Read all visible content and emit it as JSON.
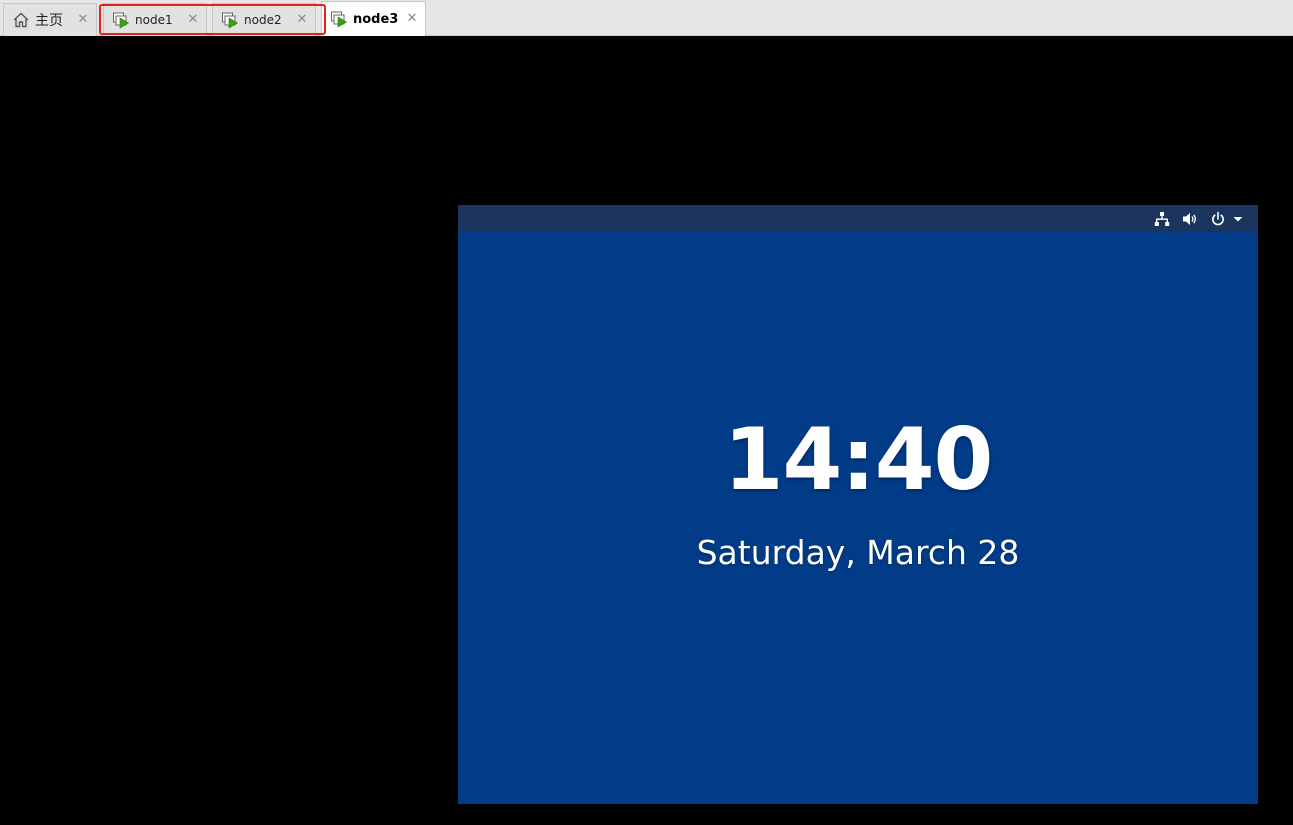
{
  "tabs": [
    {
      "label": "主页",
      "icon": "home-icon",
      "closable": true,
      "active": false
    },
    {
      "label": "node1",
      "icon": "vm-running-icon",
      "closable": true,
      "active": false
    },
    {
      "label": "node2",
      "icon": "vm-running-icon",
      "closable": true,
      "active": false
    },
    {
      "label": "node3",
      "icon": "vm-running-icon",
      "closable": true,
      "active": true
    }
  ],
  "close_glyph": "✕",
  "highlight_color": "#e0231e",
  "vm_screen": {
    "background_color": "#023c88",
    "topbar_color": "#1b355e",
    "tray_icons": [
      "network-icon",
      "volume-icon",
      "power-icon",
      "menu-dropdown-icon"
    ],
    "clock_time": "14:40",
    "date": "Saturday, March 28"
  }
}
